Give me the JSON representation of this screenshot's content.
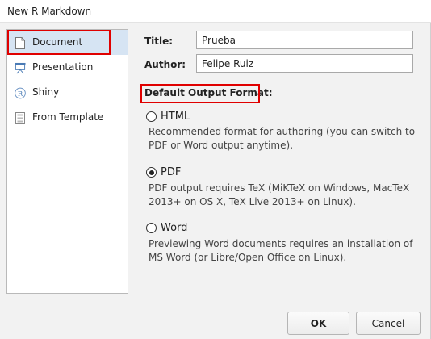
{
  "window": {
    "title": "New R Markdown"
  },
  "sidebar": {
    "items": [
      {
        "label": "Document",
        "icon": "document-icon",
        "selected": true
      },
      {
        "label": "Presentation",
        "icon": "presentation-icon",
        "selected": false
      },
      {
        "label": "Shiny",
        "icon": "shiny-r-icon",
        "selected": false
      },
      {
        "label": "From Template",
        "icon": "template-icon",
        "selected": false
      }
    ]
  },
  "form": {
    "title_label": "Title:",
    "title_value": "Prueba",
    "author_label": "Author:",
    "author_value": "Felipe Ruiz"
  },
  "output_format": {
    "heading": "Default Output Format:",
    "selected": "PDF",
    "options": [
      {
        "label": "HTML",
        "description": "Recommended format for authoring (you can switch to PDF or Word output anytime).",
        "checked": false
      },
      {
        "label": "PDF",
        "description": "PDF output requires TeX (MiKTeX on Windows, MacTeX 2013+ on OS X, TeX Live 2013+ on Linux).",
        "checked": true
      },
      {
        "label": "Word",
        "description": "Previewing Word documents requires an installation of MS Word (or Libre/Open Office on Linux).",
        "checked": false
      }
    ]
  },
  "buttons": {
    "ok": "OK",
    "cancel": "Cancel"
  },
  "colors": {
    "highlight": "#e00000",
    "selected_bg": "#d6e4f3"
  }
}
